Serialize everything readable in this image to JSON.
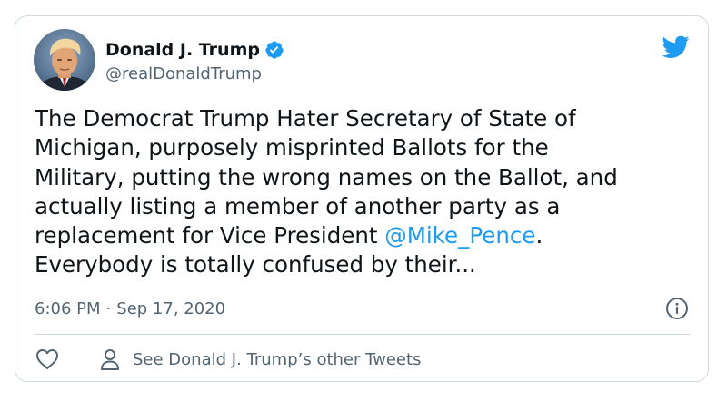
{
  "tweet": {
    "display_name": "Donald J. Trump",
    "handle": "@realDonaldTrump",
    "verified": true,
    "text_before_mention": "The Democrat Trump Hater Secretary of State of\nMichigan, purposely misprinted Ballots for the\nMilitary, putting the wrong names on the Ballot, and\nactually listing a member of another party as a\nreplacement for Vice President ",
    "mention": "@Mike_Pence",
    "text_after_mention": ".\nEverybody is totally confused by their...",
    "time": "6:06 PM",
    "separator": "·",
    "date": "Sep 17, 2020"
  },
  "actions": {
    "other_tweets_label": "See Donald J. Trump’s other Tweets"
  },
  "icons": {
    "brand": "twitter-bird-icon",
    "verified": "verified-badge-icon",
    "info": "info-icon",
    "like": "heart-icon",
    "profile": "person-icon"
  },
  "colors": {
    "accent": "#1d9bf0",
    "text": "#0f1419",
    "secondary": "#536471",
    "border": "#cfd9de"
  }
}
